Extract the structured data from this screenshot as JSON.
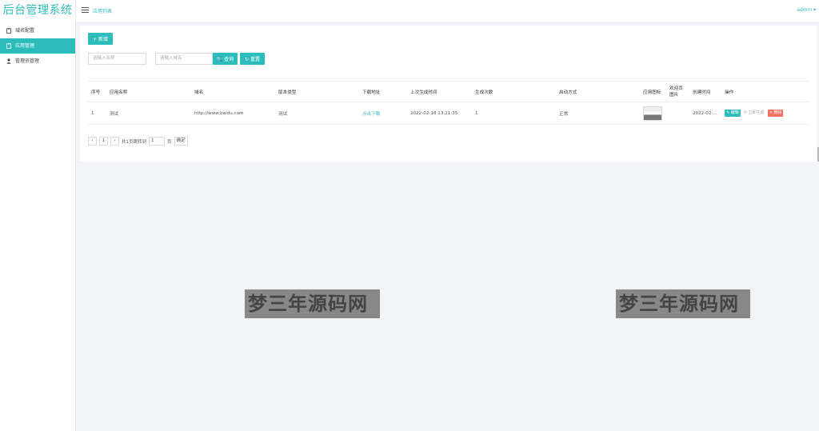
{
  "sidebar": {
    "brand": "后台管理系统",
    "items": [
      {
        "label": "域名配置",
        "icon": "clipboard-icon",
        "active": false
      },
      {
        "label": "应用管理",
        "icon": "clipboard-icon",
        "active": true
      },
      {
        "label": "管理员管理",
        "icon": "user-icon",
        "active": false
      }
    ]
  },
  "header": {
    "breadcrumb": "应用列表",
    "user": "admin ▾"
  },
  "toolbar": {
    "add_label": "+ 新增",
    "search_label": "🔍 查询",
    "reset_label": "↻ 重置",
    "name_placeholder": "请输入名称",
    "domain_placeholder": "请输入域名"
  },
  "table": {
    "headers": [
      "序号",
      "应用名称",
      "域名",
      "版本类型",
      "下载地址",
      "上次生成时间",
      "生成次数",
      "启动方式",
      "应用图标",
      "欢迎页图片",
      "创建时间",
      "操作"
    ],
    "rows": [
      {
        "index": "1",
        "name": "测试",
        "domain": "http://www.baidu.com",
        "version": "测试",
        "download": "点击下载",
        "last_gen": "2022-02-18 13:21:35",
        "gen_count": "1",
        "launch": "正常",
        "created": "2022-02-...",
        "edit": "编辑",
        "generate": "立即生成",
        "delete": "× 删除"
      }
    ]
  },
  "pager": {
    "prev": "‹",
    "page": "1",
    "next": "›",
    "summary": "共1页跳转到",
    "current": "1",
    "unit": "页",
    "confirm": "确定"
  },
  "watermark": {
    "text": "梦三年源码网"
  },
  "colors": {
    "accent": "#2cbcbc",
    "danger": "#f2705c"
  }
}
